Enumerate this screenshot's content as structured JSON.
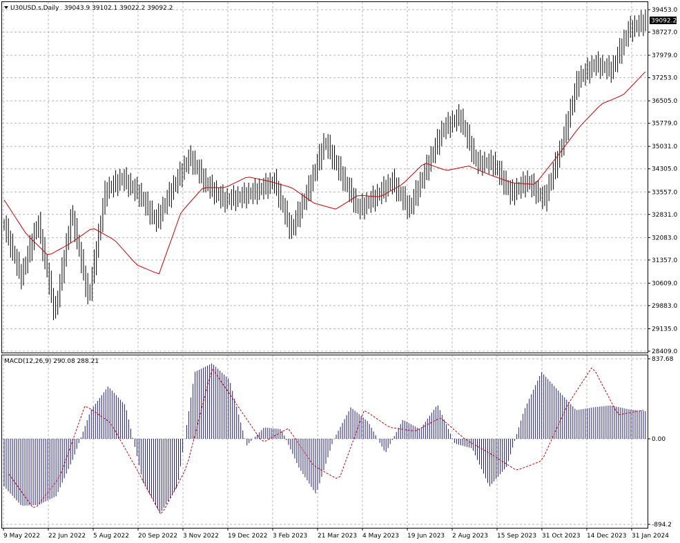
{
  "header": {
    "symbol_label": "U30USD.s,Daily",
    "ohlc_values": "39043.9 39102.1 39022.2 39092.2"
  },
  "macd_header": {
    "label": "MACD(12,26,9) 290.08 288.21"
  },
  "chart_data": [
    {
      "type": "bar",
      "subtype": "ohlc",
      "title": "U30USD.s,Daily",
      "colors": {
        "bars": "#000000",
        "moving_average": "#cc0000",
        "grid": "#b4b4b4"
      },
      "grid": true,
      "y_ticks": [
        "39453.0",
        "38727.0",
        "37979.0",
        "37253.0",
        "36505.0",
        "35779.0",
        "35031.0",
        "34305.0",
        "33557.0",
        "32831.0",
        "32083.0",
        "31357.0",
        "30609.0",
        "29883.0",
        "29135.0",
        "28409.0"
      ],
      "ylim": [
        28409.0,
        39453.0
      ],
      "last_price": "39092.2",
      "x_ticks": [
        "9 May 2022",
        "22 Jun 2022",
        "5 Aug 2022",
        "20 Sep 2022",
        "3 Nov 2022",
        "19 Dec 2022",
        "3 Feb 2023",
        "21 Mar 2023",
        "4 May 2023",
        "19 Jun 2023",
        "2 Aug 2023",
        "15 Sep 2023",
        "31 Oct 2023",
        "14 Dec 2023",
        "31 Jan 2024"
      ],
      "x": [
        "9 May 2022",
        "22 Jun 2022",
        "5 Aug 2022",
        "20 Sep 2022",
        "3 Nov 2022",
        "19 Dec 2022",
        "3 Feb 2023",
        "21 Mar 2023",
        "4 May 2023",
        "19 Jun 2023",
        "2 Aug 2023",
        "15 Sep 2023",
        "31 Oct 2023",
        "14 Dec 2023",
        "31 Jan 2024"
      ],
      "series": [
        {
          "values": [
            32500,
            30800,
            32600,
            29600,
            32900,
            30100,
            33600,
            34000,
            33500,
            32600,
            33700,
            34700,
            33800,
            33300,
            33400,
            33600,
            33900,
            32300,
            33600,
            35200,
            34100,
            33000,
            33400,
            33900,
            33000,
            34300,
            35600,
            36000,
            34500,
            34500,
            33500,
            33900,
            33300,
            35000,
            37200,
            37700,
            37500,
            38800,
            39092
          ]
        },
        {
          "name": "",
          "values": [
            33300,
            32200,
            31500,
            31900,
            32400,
            32000,
            31200,
            30900,
            32900,
            33700,
            33700,
            34050,
            33900,
            33700,
            33200,
            33000,
            33450,
            33400,
            33800,
            34500,
            34250,
            34400,
            34100,
            33850,
            33800,
            34700,
            35650,
            36400,
            36700,
            37450
          ]
        }
      ]
    },
    {
      "type": "bar",
      "title": "MACD(12,26,9) 290.08 288.21",
      "y_ticks": [
        "837.68",
        "0.00",
        "-894.2"
      ],
      "ylim": [
        -894.2,
        837.68
      ],
      "colors": {
        "histogram": "#1a1a80",
        "signal": "#cc0000"
      },
      "series": [
        {
          "values": [
            -500,
            -700,
            -690,
            -600,
            -200,
            300,
            550,
            350,
            -450,
            -780,
            -500,
            700,
            790,
            620,
            -70,
            120,
            100,
            -300,
            -580,
            -10,
            330,
            180,
            -150,
            200,
            100,
            360,
            -50,
            -100,
            -500,
            -290,
            300,
            700,
            500,
            300,
            330,
            350,
            310,
            290
          ]
        },
        {
          "values": [
            -370,
            -740,
            -400,
            350,
            170,
            -300,
            -800,
            -300,
            740,
            350,
            -40,
            110,
            -280,
            -430,
            300,
            120,
            80,
            220,
            -10,
            -160,
            -330,
            -230,
            350,
            760,
            250,
            300
          ]
        }
      ]
    }
  ]
}
